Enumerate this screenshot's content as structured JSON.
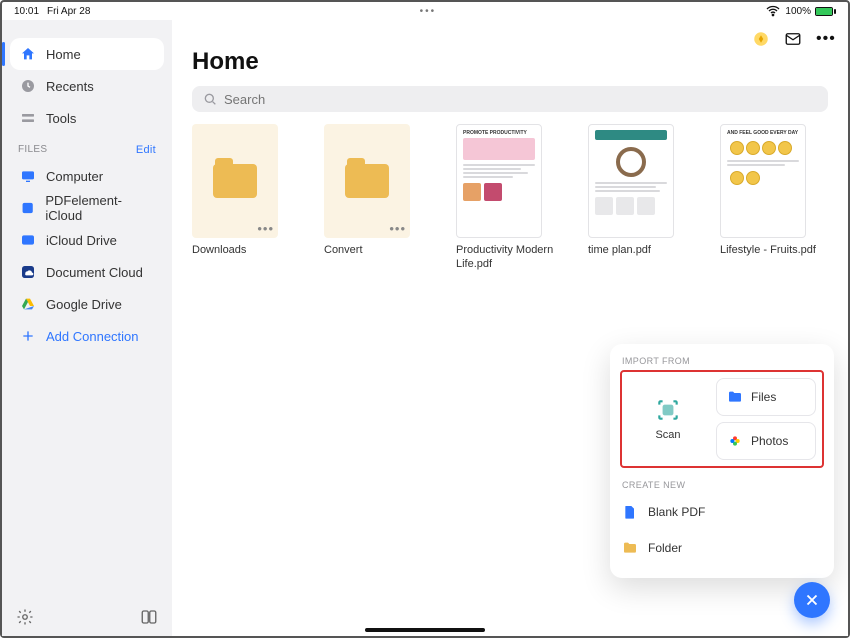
{
  "status": {
    "time": "10:01",
    "date": "Fri Apr 28",
    "battery_pct": "100%"
  },
  "sidebar": {
    "nav": [
      {
        "label": "Home",
        "icon": "home-icon"
      },
      {
        "label": "Recents",
        "icon": "clock-icon"
      },
      {
        "label": "Tools",
        "icon": "tools-icon"
      }
    ],
    "files_header": "FILES",
    "edit_label": "Edit",
    "files": [
      {
        "label": "Computer",
        "icon": "computer-icon"
      },
      {
        "label": "PDFelement-iCloud",
        "icon": "pdfelement-icon"
      },
      {
        "label": "iCloud Drive",
        "icon": "icloud-icon"
      },
      {
        "label": "Document Cloud",
        "icon": "doccloud-icon"
      },
      {
        "label": "Google Drive",
        "icon": "gdrive-icon"
      }
    ],
    "add_connection": "Add Connection"
  },
  "main": {
    "title": "Home",
    "search_placeholder": "Search",
    "items": [
      {
        "label": "Downloads",
        "type": "folder"
      },
      {
        "label": "Convert",
        "type": "folder"
      },
      {
        "label": "Productivity Modern Life.pdf",
        "type": "doc_pink"
      },
      {
        "label": "time plan.pdf",
        "type": "doc_teal"
      },
      {
        "label": "Lifestyle - Fruits.pdf",
        "type": "doc_fruit"
      }
    ]
  },
  "popover": {
    "import_header": "IMPORT FROM",
    "scan_label": "Scan",
    "files_label": "Files",
    "photos_label": "Photos",
    "create_header": "CREATE NEW",
    "blank_pdf": "Blank PDF",
    "folder": "Folder"
  },
  "doc_sample_titles": {
    "pink": "PROMOTE PRODUCTIVITY",
    "fruit": "AND FEEL GOOD EVERY DAY"
  }
}
